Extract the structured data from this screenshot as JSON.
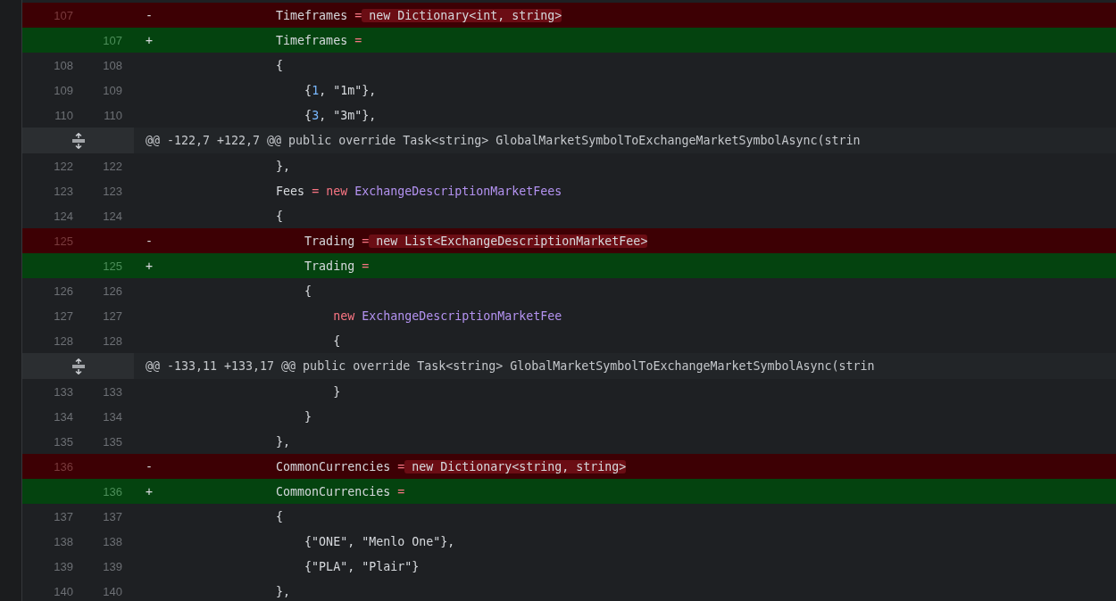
{
  "rows": [
    {
      "kind": "del",
      "old": "107",
      "sign": "-",
      "segments": [
        {
          "kind": "text",
          "text": "                Timeframes "
        },
        {
          "kind": "op",
          "text": "="
        },
        {
          "kind": "changed",
          "text": " new Dictionary<int, string>"
        }
      ]
    },
    {
      "kind": "add",
      "new": "107",
      "sign": "+",
      "segments": [
        {
          "kind": "text",
          "text": "                Timeframes "
        },
        {
          "kind": "op",
          "text": "="
        }
      ]
    },
    {
      "kind": "context",
      "old": "108",
      "new": "108",
      "segments": [
        {
          "kind": "text",
          "text": "                {"
        }
      ]
    },
    {
      "kind": "context",
      "old": "109",
      "new": "109",
      "segments": [
        {
          "kind": "text",
          "text": "                    {"
        },
        {
          "kind": "number",
          "text": "1"
        },
        {
          "kind": "text",
          "text": ", \"1m\"},"
        }
      ]
    },
    {
      "kind": "context",
      "old": "110",
      "new": "110",
      "segments": [
        {
          "kind": "text",
          "text": "                    {"
        },
        {
          "kind": "number",
          "text": "3"
        },
        {
          "kind": "text",
          "text": ", \"3m\"},"
        }
      ]
    },
    {
      "kind": "hunk",
      "text": "@@ -122,7 +122,7 @@ public override Task<string> GlobalMarketSymbolToExchangeMarketSymbolAsync(strin"
    },
    {
      "kind": "context",
      "old": "122",
      "new": "122",
      "segments": [
        {
          "kind": "text",
          "text": "                },"
        }
      ]
    },
    {
      "kind": "context",
      "old": "123",
      "new": "123",
      "segments": [
        {
          "kind": "text",
          "text": "                Fees "
        },
        {
          "kind": "op",
          "text": "="
        },
        {
          "kind": "keyword",
          "text": " new "
        },
        {
          "kind": "type",
          "text": "ExchangeDescriptionMarketFees"
        }
      ]
    },
    {
      "kind": "context",
      "old": "124",
      "new": "124",
      "segments": [
        {
          "kind": "text",
          "text": "                {"
        }
      ]
    },
    {
      "kind": "del",
      "old": "125",
      "sign": "-",
      "segments": [
        {
          "kind": "text",
          "text": "                    Trading "
        },
        {
          "kind": "op",
          "text": "="
        },
        {
          "kind": "changed",
          "text": " new List<ExchangeDescriptionMarketFee>"
        }
      ]
    },
    {
      "kind": "add",
      "new": "125",
      "sign": "+",
      "segments": [
        {
          "kind": "text",
          "text": "                    Trading "
        },
        {
          "kind": "op",
          "text": "="
        }
      ]
    },
    {
      "kind": "context",
      "old": "126",
      "new": "126",
      "segments": [
        {
          "kind": "text",
          "text": "                    {"
        }
      ]
    },
    {
      "kind": "context",
      "old": "127",
      "new": "127",
      "segments": [
        {
          "kind": "keyword",
          "text": "                        new "
        },
        {
          "kind": "type",
          "text": "ExchangeDescriptionMarketFee"
        }
      ]
    },
    {
      "kind": "context",
      "old": "128",
      "new": "128",
      "segments": [
        {
          "kind": "text",
          "text": "                        {"
        }
      ]
    },
    {
      "kind": "hunk",
      "text": "@@ -133,11 +133,17 @@ public override Task<string> GlobalMarketSymbolToExchangeMarketSymbolAsync(strin"
    },
    {
      "kind": "context",
      "old": "133",
      "new": "133",
      "segments": [
        {
          "kind": "text",
          "text": "                        }"
        }
      ]
    },
    {
      "kind": "context",
      "old": "134",
      "new": "134",
      "segments": [
        {
          "kind": "text",
          "text": "                    }"
        }
      ]
    },
    {
      "kind": "context",
      "old": "135",
      "new": "135",
      "segments": [
        {
          "kind": "text",
          "text": "                },"
        }
      ]
    },
    {
      "kind": "del",
      "old": "136",
      "sign": "-",
      "segments": [
        {
          "kind": "text",
          "text": "                CommonCurrencies "
        },
        {
          "kind": "op",
          "text": "="
        },
        {
          "kind": "changed",
          "text": " new Dictionary<string, string>"
        }
      ]
    },
    {
      "kind": "add",
      "new": "136",
      "sign": "+",
      "segments": [
        {
          "kind": "text",
          "text": "                CommonCurrencies "
        },
        {
          "kind": "op",
          "text": "="
        }
      ]
    },
    {
      "kind": "context",
      "old": "137",
      "new": "137",
      "segments": [
        {
          "kind": "text",
          "text": "                {"
        }
      ]
    },
    {
      "kind": "context",
      "old": "138",
      "new": "138",
      "segments": [
        {
          "kind": "text",
          "text": "                    {\"ONE\", \"Menlo One\"},"
        }
      ]
    },
    {
      "kind": "context",
      "old": "139",
      "new": "139",
      "segments": [
        {
          "kind": "text",
          "text": "                    {\"PLA\", \"Plair\"}"
        }
      ]
    },
    {
      "kind": "context",
      "old": "140",
      "new": "140",
      "segments": [
        {
          "kind": "text",
          "text": "                },"
        }
      ]
    }
  ]
}
